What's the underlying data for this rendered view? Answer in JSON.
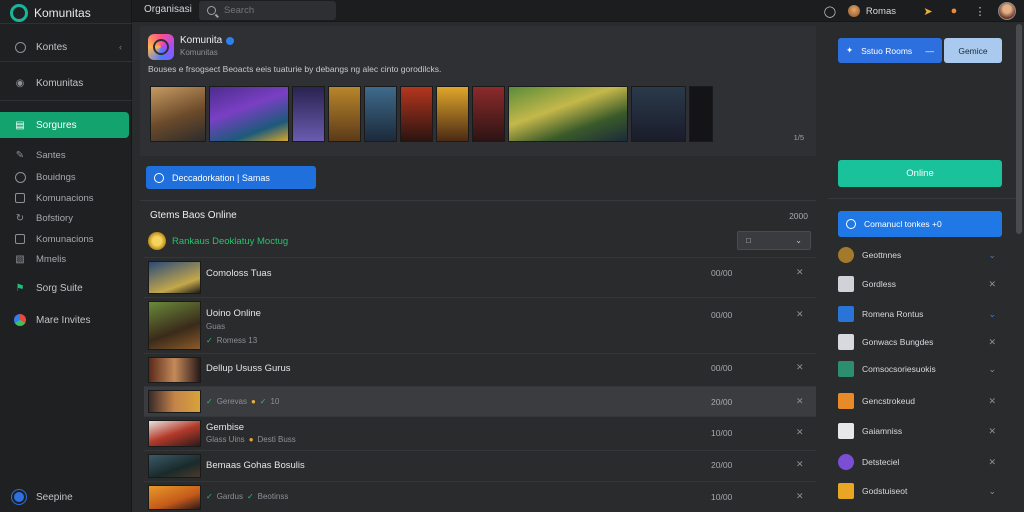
{
  "app": {
    "name": "Komunitas"
  },
  "topbar": {
    "title": "Organisasi",
    "search_placeholder": "Search",
    "user_name": "Romas"
  },
  "sidebar": {
    "items": [
      {
        "label": "Komunitas",
        "icon": "community-icon"
      },
      {
        "label": "Sorgures",
        "icon": "chart-icon"
      }
    ],
    "sub_items": [
      {
        "label": "Santes"
      },
      {
        "label": "Bouidngs"
      },
      {
        "label": "Komunacions"
      },
      {
        "label": "Bofstiory"
      },
      {
        "label": "Komunacions"
      },
      {
        "label": "Mmelis"
      }
    ],
    "extra": [
      {
        "label": "Sorg Suite"
      },
      {
        "label": "Mare Invites"
      }
    ],
    "top_label": "Kontes",
    "bottom_label": "Seepine"
  },
  "profile": {
    "name": "Komunita",
    "subtitle": "Komunitas",
    "description": "Bouses e frsogsect Beoacts eeis tuaturie by debangs ng alec cinto gorodilcks.",
    "pager": "1/5"
  },
  "action": {
    "desc_button": "Deccadorkation | Samas"
  },
  "members": {
    "title": "Gtems Baos Online",
    "count": "2000",
    "group_label": "Rankaus Deoklatuy Moctug",
    "rows": [
      {
        "name": "Comoloss Tuas",
        "meta": "",
        "time": "00/00"
      },
      {
        "name": "Uoino Online",
        "meta1": "Guas",
        "meta2": "Romess 13",
        "time": "00/00"
      },
      {
        "name": "Dellup Ususs Gurus",
        "meta": "",
        "time": "00/00"
      },
      {
        "name": "",
        "meta": "Gerevas",
        "meta_b": "10",
        "time": "20/00"
      },
      {
        "name": "Gembise",
        "meta": "Glass Uins",
        "meta_b": "Desti Buss",
        "time": "10/00"
      },
      {
        "name": "Bemaas Gohas Bosulis",
        "meta": "",
        "time": "20/00"
      },
      {
        "name": "",
        "meta": "Gardus",
        "meta_b": "Beotinss",
        "time": "10/00"
      }
    ]
  },
  "right": {
    "split_button": "Sstuo Rooms",
    "ghost_button": "Gemice",
    "cta_button": "Online",
    "active_item": "Comanucl tonkes +0",
    "items": [
      {
        "label": "Geottnnes",
        "color": "#a37a2c"
      },
      {
        "label": "Gordless",
        "color": "#cfd3d8"
      },
      {
        "label": "Romena Rontus",
        "color": "#2a74d8"
      },
      {
        "label": "Gonwacs Bungdes",
        "color": "#d6d9dd"
      },
      {
        "label": "Comsocsoriesuokis",
        "color": "#2c8e6f"
      },
      {
        "label": "Gencstrokeud",
        "color": "#e88a2a"
      },
      {
        "label": "Gaiamniss",
        "color": "#e6e8ea"
      },
      {
        "label": "Detsteciel",
        "color": "#7a4fd6"
      },
      {
        "label": "Godstuiseot",
        "color": "#e8a624"
      }
    ]
  }
}
